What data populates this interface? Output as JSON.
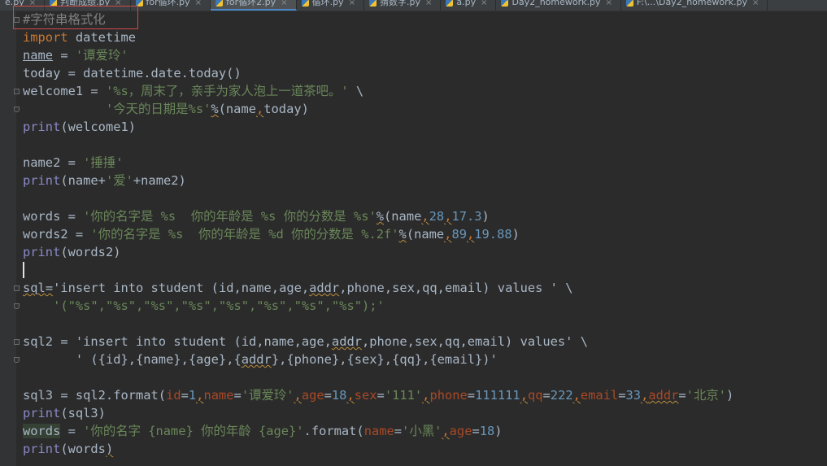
{
  "tabs": [
    {
      "label": "e.py"
    },
    {
      "label": "判断成绩.py"
    },
    {
      "label": "for循环.py"
    },
    {
      "label": "for循环2.py",
      "active": true
    },
    {
      "label": "循环.py"
    },
    {
      "label": "猜数字.py"
    },
    {
      "label": "a.py"
    },
    {
      "label": "Day2_homework.py"
    },
    {
      "label": "F:\\...\\Day2_homework.py"
    }
  ],
  "code": [
    [
      {
        "t": "#字符串格式化",
        "c": "cmt"
      }
    ],
    [
      {
        "t": "import",
        "c": "kw"
      },
      {
        "t": " datetime"
      }
    ],
    [
      {
        "t": "name",
        "c": "und"
      },
      {
        "t": " = "
      },
      {
        "t": "'谭爱玲'",
        "c": "str"
      }
    ],
    [
      {
        "t": "today = datetime.date.today()"
      }
    ],
    [
      {
        "t": "welcome1 = "
      },
      {
        "t": "'%s，周末了，亲手为家人泡上一道茶吧。'",
        "c": "str"
      },
      {
        "t": " \\"
      }
    ],
    [
      {
        "t": "           "
      },
      {
        "t": "'今天的日期是%s'",
        "c": "str"
      },
      {
        "t": "%",
        "c": "sq"
      },
      {
        "t": "(name"
      },
      {
        "t": ",",
        "c": "kw sq"
      },
      {
        "t": "today)"
      }
    ],
    [
      {
        "t": "print",
        "c": "bi"
      },
      {
        "t": "(welcome1)"
      }
    ],
    [
      {
        "t": ""
      }
    ],
    [
      {
        "t": "name2 = "
      },
      {
        "t": "'捶捶'",
        "c": "str"
      }
    ],
    [
      {
        "t": "print",
        "c": "bi"
      },
      {
        "t": "(name+"
      },
      {
        "t": "'爱'",
        "c": "str"
      },
      {
        "t": "+name2)"
      }
    ],
    [
      {
        "t": ""
      }
    ],
    [
      {
        "t": "words = "
      },
      {
        "t": "'你的名字是 %s  你的年龄是 %s 你的分数是 %s'",
        "c": "str"
      },
      {
        "t": "%",
        "c": "sq"
      },
      {
        "t": "(name"
      },
      {
        "t": ",",
        "c": "kw sq"
      },
      {
        "t": "28",
        "c": "num"
      },
      {
        "t": ",",
        "c": "kw sq"
      },
      {
        "t": "17.3",
        "c": "num"
      },
      {
        "t": ")"
      }
    ],
    [
      {
        "t": "words2 = "
      },
      {
        "t": "'你的名字是 %s  你的年龄是 %d 你的分数是 %.2f'",
        "c": "str"
      },
      {
        "t": "%",
        "c": "sq"
      },
      {
        "t": "(name"
      },
      {
        "t": ",",
        "c": "kw sq"
      },
      {
        "t": "89",
        "c": "num"
      },
      {
        "t": ",",
        "c": "kw sq"
      },
      {
        "t": "19.88",
        "c": "num"
      },
      {
        "t": ")"
      }
    ],
    [
      {
        "t": "print",
        "c": "bi"
      },
      {
        "t": "(words2)"
      }
    ],
    [
      {
        "t": ""
      }
    ],
    [
      {
        "t": "sql",
        "c": "sq"
      },
      {
        "t": "=",
        "c": "sq"
      },
      {
        "t": "'insert into student (id,name,age,"
      },
      {
        "t": "addr",
        "c": "sq"
      },
      {
        "t": ",phone,sex,qq,email) values '",
        "c": ""
      },
      {
        "t": " \\"
      }
    ],
    [
      {
        "t": "    "
      },
      {
        "t": "'(\"%s\",\"%s\",\"%s\",\"%s\",\"%s\",\"%s\",\"%s\",\"%s\");'",
        "c": "str"
      }
    ],
    [
      {
        "t": ""
      }
    ],
    [
      {
        "t": "sql2 = "
      },
      {
        "t": "'insert into student (id,name,age,"
      },
      {
        "t": "addr",
        "c": "sq"
      },
      {
        "t": ",phone,sex,qq,email) values'"
      },
      {
        "t": " \\"
      }
    ],
    [
      {
        "t": "       "
      },
      {
        "t": "' ({id},{name},{age},{"
      },
      {
        "t": "addr",
        "c": "sq"
      },
      {
        "t": "},{phone},{sex},{qq},{email})'"
      }
    ],
    [
      {
        "t": ""
      }
    ],
    [
      {
        "t": "sql3 = sql2.format("
      },
      {
        "t": "id",
        "c": "par"
      },
      {
        "t": "="
      },
      {
        "t": "1",
        "c": "num"
      },
      {
        "t": ",",
        "c": "kw sq"
      },
      {
        "t": "name",
        "c": "par"
      },
      {
        "t": "="
      },
      {
        "t": "'谭爱玲'",
        "c": "str"
      },
      {
        "t": ",",
        "c": "kw sq"
      },
      {
        "t": "age",
        "c": "par"
      },
      {
        "t": "="
      },
      {
        "t": "18",
        "c": "num"
      },
      {
        "t": ",",
        "c": "kw sq"
      },
      {
        "t": "sex",
        "c": "par"
      },
      {
        "t": "="
      },
      {
        "t": "'111'",
        "c": "str"
      },
      {
        "t": ",",
        "c": "kw sq"
      },
      {
        "t": "phone",
        "c": "par"
      },
      {
        "t": "="
      },
      {
        "t": "111111",
        "c": "num"
      },
      {
        "t": ",",
        "c": "kw sq"
      },
      {
        "t": "qq",
        "c": "par"
      },
      {
        "t": "="
      },
      {
        "t": "222",
        "c": "num"
      },
      {
        "t": ",",
        "c": "kw sq"
      },
      {
        "t": "email",
        "c": "par"
      },
      {
        "t": "="
      },
      {
        "t": "33",
        "c": "num"
      },
      {
        "t": ",",
        "c": "kw sq"
      },
      {
        "t": "addr",
        "c": "par sq"
      },
      {
        "t": "="
      },
      {
        "t": "'北京'",
        "c": "str"
      },
      {
        "t": ")"
      }
    ],
    [
      {
        "t": "print",
        "c": "bi"
      },
      {
        "t": "(sql3)"
      }
    ],
    [
      {
        "t": "words",
        "c": "hl"
      },
      {
        "t": " = "
      },
      {
        "t": "'你的名字 {name} 你的年龄 {age}'",
        "c": "str"
      },
      {
        "t": ".format("
      },
      {
        "t": "name",
        "c": "par"
      },
      {
        "t": "="
      },
      {
        "t": "'小黑'",
        "c": "str"
      },
      {
        "t": ",",
        "c": "kw sq"
      },
      {
        "t": "age",
        "c": "par"
      },
      {
        "t": "="
      },
      {
        "t": "18",
        "c": "num"
      },
      {
        "t": ")"
      }
    ],
    [
      {
        "t": "print",
        "c": "bi"
      },
      {
        "t": "(words"
      },
      {
        "t": ")",
        "c": "sq"
      }
    ]
  ]
}
